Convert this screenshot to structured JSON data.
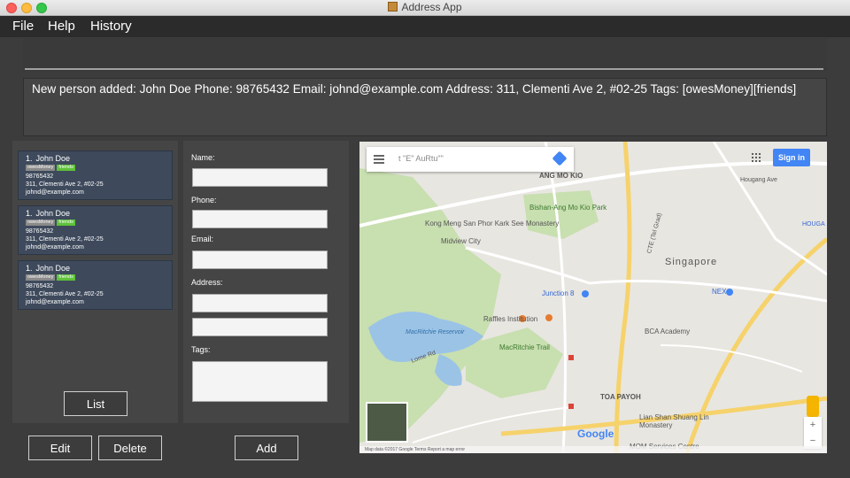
{
  "window": {
    "title": "Address App"
  },
  "menu": {
    "file": "File",
    "help": "Help",
    "history": "History"
  },
  "command": {
    "value": ""
  },
  "result": {
    "text": "New person added: John Doe Phone: 98765432 Email: johnd@example.com Address: 311, Clementi Ave 2, #02-25 Tags: [owesMoney][friends]"
  },
  "persons": [
    {
      "index": "1.",
      "name": "John Doe",
      "tags": [
        "owesMoney",
        "friends"
      ],
      "phone": "98765432",
      "address": "311, Clementi Ave 2, #02-25",
      "email": "johnd@example.com"
    },
    {
      "index": "1.",
      "name": "John Doe",
      "tags": [
        "owesMoney",
        "friends"
      ],
      "phone": "98765432",
      "address": "311, Clementi Ave 2, #02-25",
      "email": "johnd@example.com"
    },
    {
      "index": "1.",
      "name": "John Doe",
      "tags": [
        "owesMoney",
        "friends"
      ],
      "phone": "98765432",
      "address": "311, Clementi Ave 2, #02-25",
      "email": "johnd@example.com"
    }
  ],
  "buttons": {
    "list": "List",
    "edit": "Edit",
    "delete": "Delete",
    "add": "Add"
  },
  "form": {
    "name_label": "Name:",
    "phone_label": "Phone:",
    "email_label": "Email:",
    "address_label": "Address:",
    "tags_label": "Tags:"
  },
  "map": {
    "search_text": "t \"E\" AuRtu\"\"",
    "signin": "Sign in",
    "google": "Google",
    "labels": {
      "ang_mo_kio": "ANG MO KIO",
      "bishan_park": "Bishan-Ang Mo Kio Park",
      "kong_meng": "Kong Meng San Phor Kark See Monastery",
      "midview": "Midview City",
      "singapore": "Singapore",
      "junction8": "Junction 8",
      "nex": "NEX",
      "raffles": "Raffles Institution",
      "bca": "BCA Academy",
      "macritchie": "MacRitchie Trail",
      "reservoir": "MacRitchie Reservoir",
      "toa_payoh": "TOA PAYOH",
      "lian_shan": "Lian Shan Shuang Lin Monastery",
      "mom": "MOM Services Centre",
      "hougang": "Hougang Ave",
      "ctek": "CTE (Tel Grad)",
      "lorne": "Lorne Rd",
      "houga": "HOUGA"
    },
    "footer": "Map data ©2017 Google   Terms   Report a map error",
    "zoom_in": "+",
    "zoom_out": "−"
  },
  "colors": {
    "card": "#3e4a5c",
    "tag_owes": "#8a8a8a",
    "tag_friends": "#5ec23a",
    "map_accent": "#4285f4"
  }
}
